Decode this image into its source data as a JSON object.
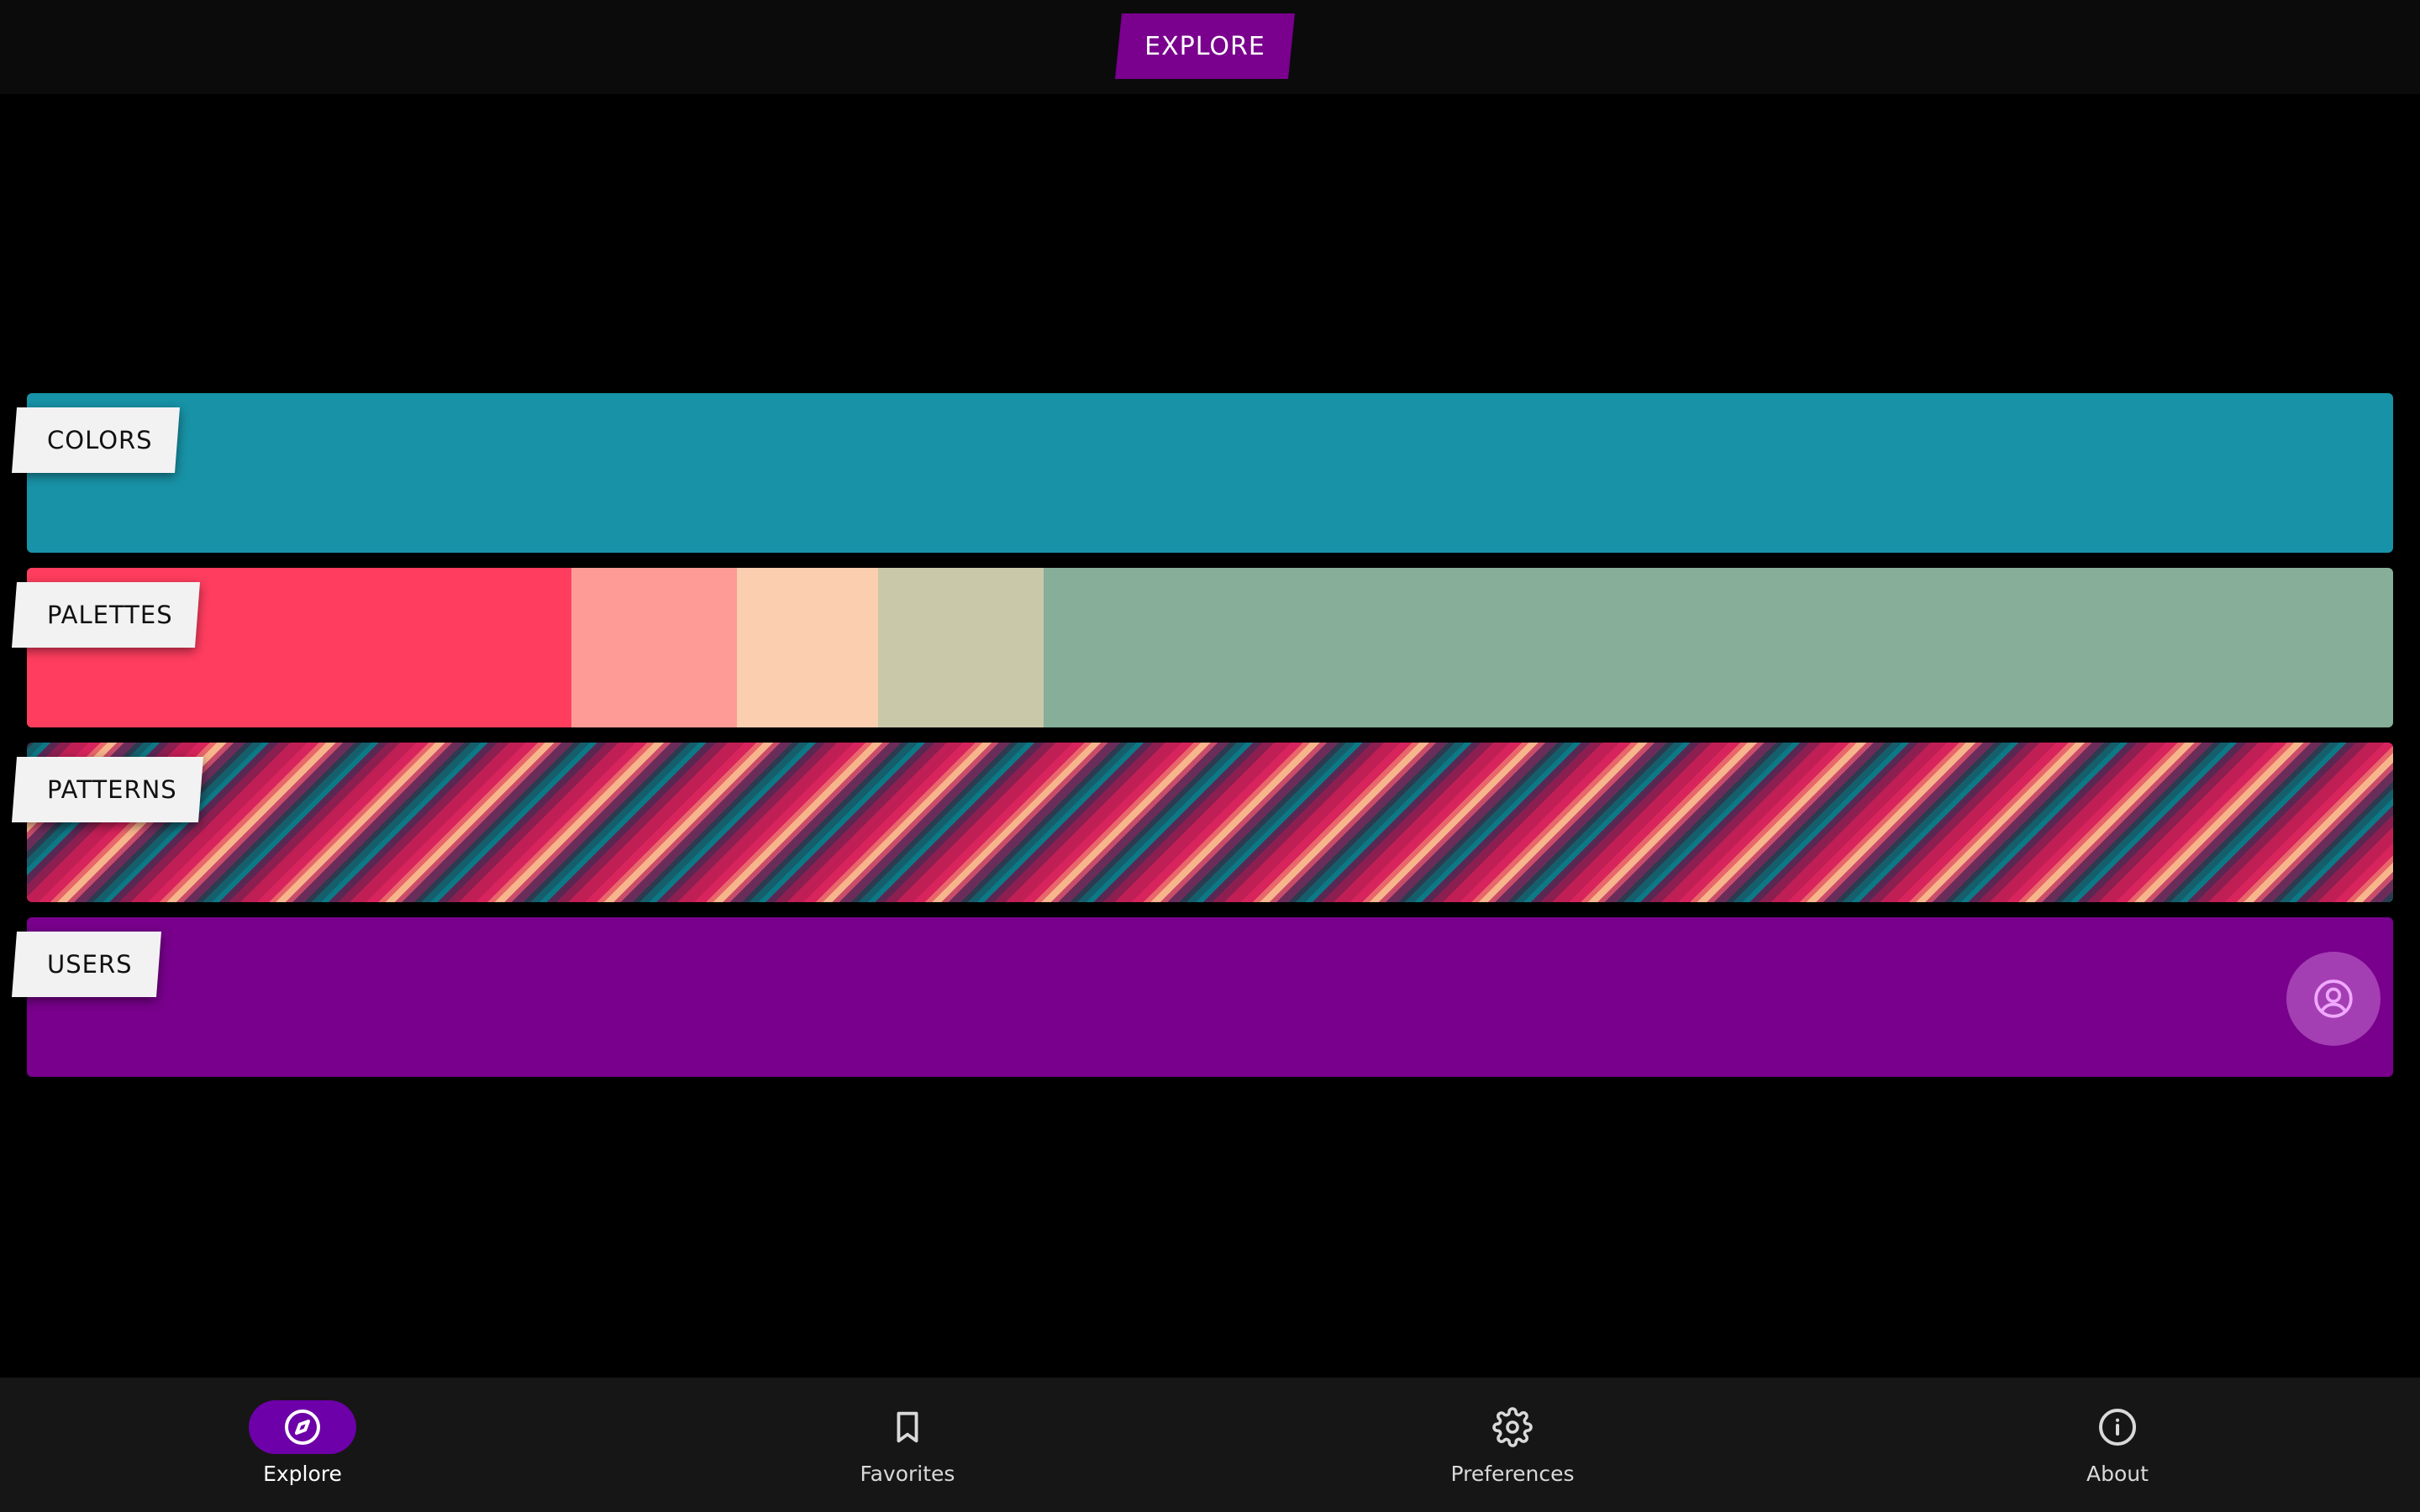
{
  "header": {
    "title": "EXPLORE"
  },
  "categories": {
    "colors": {
      "label": "COLORS",
      "color": "#1892a6"
    },
    "palettes": {
      "label": "PALETTES",
      "swatches": [
        "#ff3d5f",
        "#ff9b96",
        "#fcceb0",
        "#c9c8a8",
        "#86ae98"
      ]
    },
    "patterns": {
      "label": "PATTERNS"
    },
    "users": {
      "label": "USERS",
      "color": "#78008c",
      "icon": "user-circle-icon"
    }
  },
  "bottom_nav": {
    "items": [
      {
        "label": "Explore",
        "icon": "compass-icon",
        "active": true
      },
      {
        "label": "Favorites",
        "icon": "bookmark-icon",
        "active": false
      },
      {
        "label": "Preferences",
        "icon": "gear-icon",
        "active": false
      },
      {
        "label": "About",
        "icon": "info-icon",
        "active": false
      }
    ]
  },
  "colors": {
    "accent": "#7a008e",
    "nav_active": "#6d00a8",
    "background": "#000000"
  }
}
